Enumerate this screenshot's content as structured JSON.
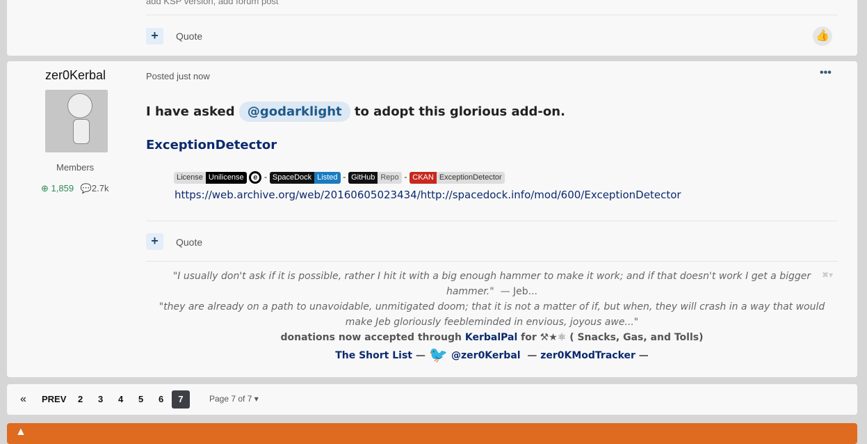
{
  "prev_post": {
    "last_line": "add KSP version, add forum post",
    "quote_label": "Quote"
  },
  "post": {
    "author": "zer0Kerbal",
    "group": "Members",
    "reputation": "1,859",
    "posts": "2.7k",
    "posted": "Posted just now",
    "intro_before": "I have asked",
    "mention": "@godarklight",
    "intro_after": "to adopt  this glorious add-on.",
    "mod_link": "ExceptionDetector",
    "badges": [
      {
        "left": "License",
        "right": "Unilicense",
        "left_color": "#777",
        "right_color": "#000"
      },
      {
        "left": "SpaceDock",
        "right": "Listed",
        "left_color": "#111",
        "right_color": "#1a7bc0"
      },
      {
        "left": "GitHub",
        "right": "Repo",
        "left_color": "#111",
        "right_color": "#ccc"
      },
      {
        "left": "CKAN",
        "right": "ExceptionDetector",
        "left_color": "#c8281e",
        "right_color": "#ccc"
      }
    ],
    "separator": "-",
    "archive_url": "https://web.archive.org/web/20160605023434/http://spacedock.info/mod/600/ExceptionDetector",
    "quote_label": "Quote",
    "signature": {
      "quote1": "\"I usually don't ask if it is possible, rather I hit it with a big enough hammer to make it work; and if that doesn't work I get a bigger hammer.\"",
      "quote1_attr": "— Jeb...",
      "quote2": "\"they are already on a path to unavoidable, unmitigated doom; that it is not a matter of if, but when, they will crash in a way that would make Jeb gloriously feebleminded in envious, joyous awe...\"",
      "donations_before": "donations now accepted through",
      "kerbalpal": "KerbalPal",
      "for": "for",
      "donations_after": "( Snacks, Gas, and Tolls)",
      "short_list": "The Short List",
      "dash": "—",
      "twitter": "@zer0Kerbal",
      "tracker": "zer0KModTracker"
    }
  },
  "pagination": {
    "first": "«",
    "prev": "PREV",
    "pages": [
      "2",
      "3",
      "4",
      "5",
      "6",
      "7"
    ],
    "current": "7",
    "page_label": "Page 7 of 7"
  },
  "colors": {
    "accent": "#0b2a6e",
    "banner": "#de6b20",
    "mention_bg": "#dce8f3"
  }
}
